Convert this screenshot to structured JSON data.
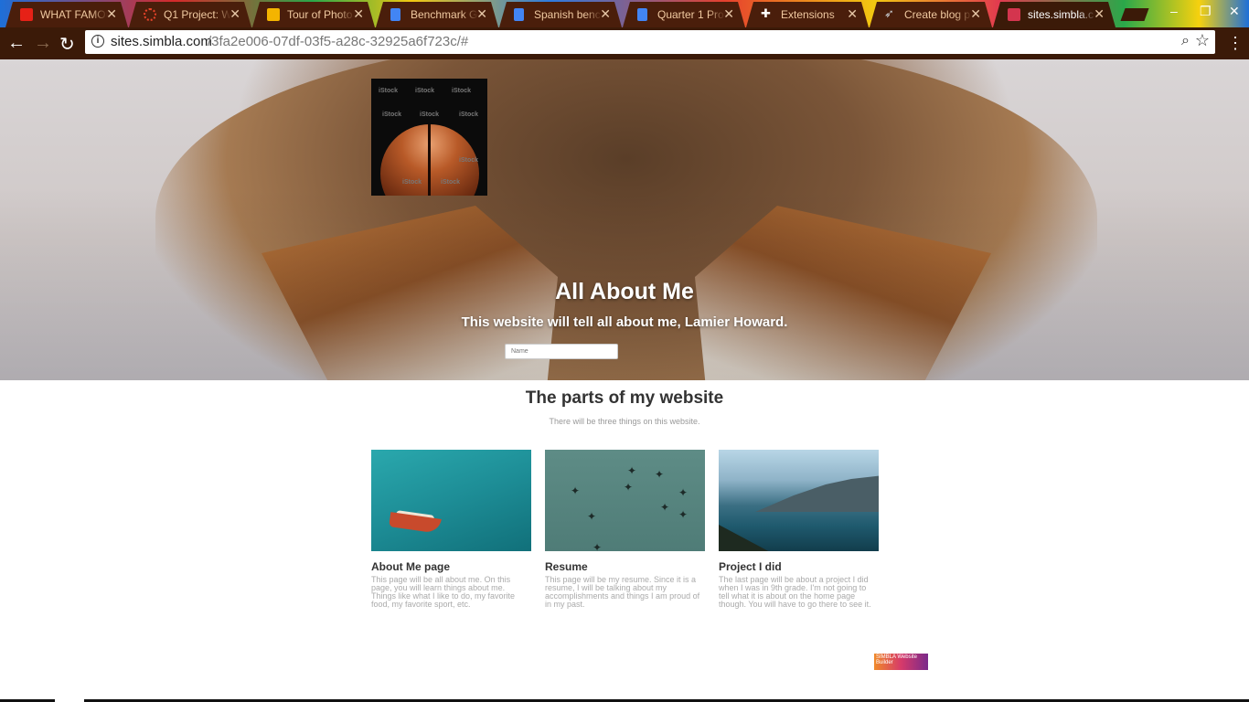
{
  "tabs": [
    {
      "title": "WHAT FAMOUS",
      "icon": "youtube-icon",
      "color": "#e62117"
    },
    {
      "title": "Q1 Project: W",
      "icon": "loading-spinner-icon",
      "color": "#e8432a"
    },
    {
      "title": "Tour of Photo",
      "icon": "slides-icon",
      "color": "#f4b400"
    },
    {
      "title": "Benchmark G",
      "icon": "docs-icon",
      "color": "#4285f4"
    },
    {
      "title": "Spanish benc",
      "icon": "docs-icon",
      "color": "#4285f4"
    },
    {
      "title": "Quarter 1 Pro",
      "icon": "docs-icon",
      "color": "#4285f4"
    },
    {
      "title": "Extensions",
      "icon": "puzzle-icon",
      "color": "#ffffff"
    },
    {
      "title": "Create blog p",
      "icon": "rocket-icon",
      "color": "#9aa0a6"
    },
    {
      "title": "sites.simbla.c",
      "icon": "simbla-icon",
      "color": "#d4354e",
      "active": true
    }
  ],
  "close_glyph": "✕",
  "address_bar": {
    "host": "sites.simbla.com",
    "path": "/3fa2e006-07df-03f5-a28c-32925a6f723c/#"
  },
  "hero": {
    "logo_watermark": "iStock",
    "title": "All About Me",
    "subtitle": "This website will tell all about me, Lamier Howard.",
    "input_placeholder": "Name"
  },
  "section": {
    "title": "The parts of my website",
    "subtitle": "There will be three things on this website."
  },
  "cards": [
    {
      "title": "About Me page",
      "description": "This page will be all about me. On this page, you will learn things about me. Things like what I like to do, my favorite food, my favorite sport, etc."
    },
    {
      "title": "Resume",
      "description": "This page will be my resume. Since it is a resume, I will be talking about my accomplishments and things I am proud of in my past."
    },
    {
      "title": "Project I did",
      "description": "The last page will be about a project I did when I was in 9th grade. I'm not going to tell what it is about on the home page though. You will have to go there to see it."
    }
  ],
  "badge": {
    "text": "SIMBLA Website Builder"
  }
}
